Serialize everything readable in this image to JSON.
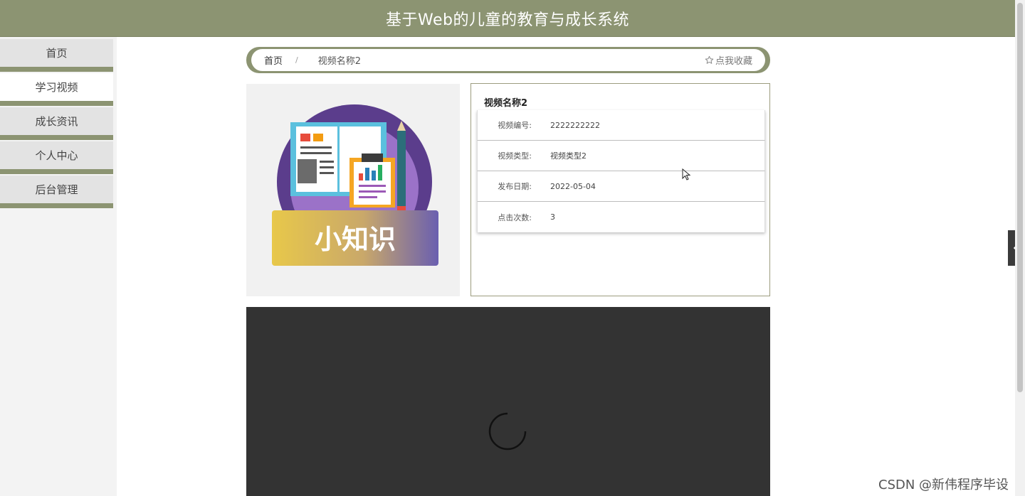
{
  "header": {
    "title": "基于Web的儿童的教育与成长系统"
  },
  "sidebar": {
    "items": [
      {
        "label": "首页",
        "active": false
      },
      {
        "label": "学习视频",
        "active": true
      },
      {
        "label": "成长资讯",
        "active": false
      },
      {
        "label": "个人中心",
        "active": false
      },
      {
        "label": "后台管理",
        "active": false
      }
    ]
  },
  "breadcrumb": {
    "home": "首页",
    "separator": "/",
    "current": "视频名称2",
    "favorite_label": "点我收藏",
    "favorite_icon": "star-outline-icon"
  },
  "cover": {
    "text": "小知识"
  },
  "detail": {
    "title": "视频名称2",
    "rows": [
      {
        "label": "视频编号:",
        "value": "2222222222"
      },
      {
        "label": "视频类型:",
        "value": "视频类型2"
      },
      {
        "label": "发布日期:",
        "value": "2022-05-04"
      },
      {
        "label": "点击次数:",
        "value": "3"
      }
    ]
  },
  "side_tab": {
    "icon": "chevron-left-icon"
  },
  "watermark": "CSDN @新伟程序毕设",
  "colors": {
    "header": "#8c9472",
    "sidebar": "#f3f3f3",
    "video_bg": "#333333"
  }
}
